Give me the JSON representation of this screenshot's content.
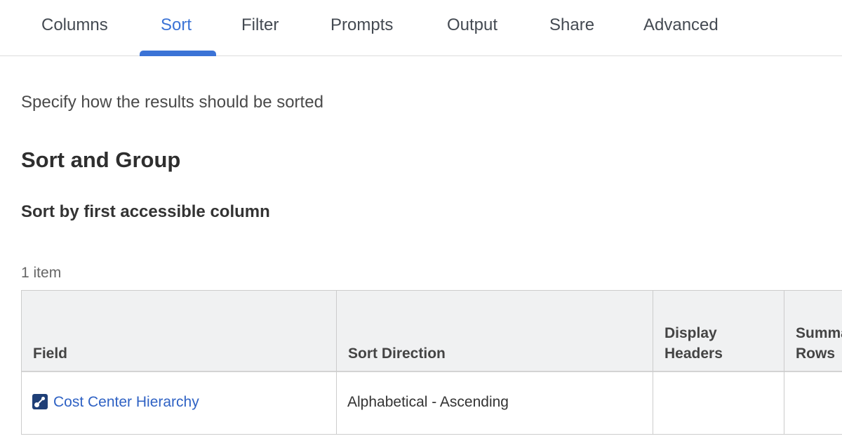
{
  "tabs": [
    {
      "label": "Columns"
    },
    {
      "label": "Sort"
    },
    {
      "label": "Filter"
    },
    {
      "label": "Prompts"
    },
    {
      "label": "Output"
    },
    {
      "label": "Share"
    },
    {
      "label": "Advanced"
    }
  ],
  "active_tab": "Sort",
  "intro_text": "Specify how the results should be sorted",
  "section_title": "Sort and Group",
  "sort_option_label": "Sort by first accessible column",
  "item_count": "1 item",
  "grid": {
    "headers": {
      "field": "Field",
      "sort_direction": "Sort Direction",
      "display_headers_line1": "Display",
      "display_headers_line2": "Headers",
      "summary_rows_line1": "Summa",
      "summary_rows_line2": "Rows"
    },
    "rows": [
      {
        "field": "Cost Center Hierarchy",
        "field_icon": "hierarchy-field-icon",
        "sort_direction": "Alphabetical - Ascending",
        "display_headers": "",
        "summary_rows": ""
      }
    ]
  },
  "colors": {
    "accent": "#3b73d6",
    "link": "#2f62c4",
    "header_bg": "#f0f1f2"
  }
}
